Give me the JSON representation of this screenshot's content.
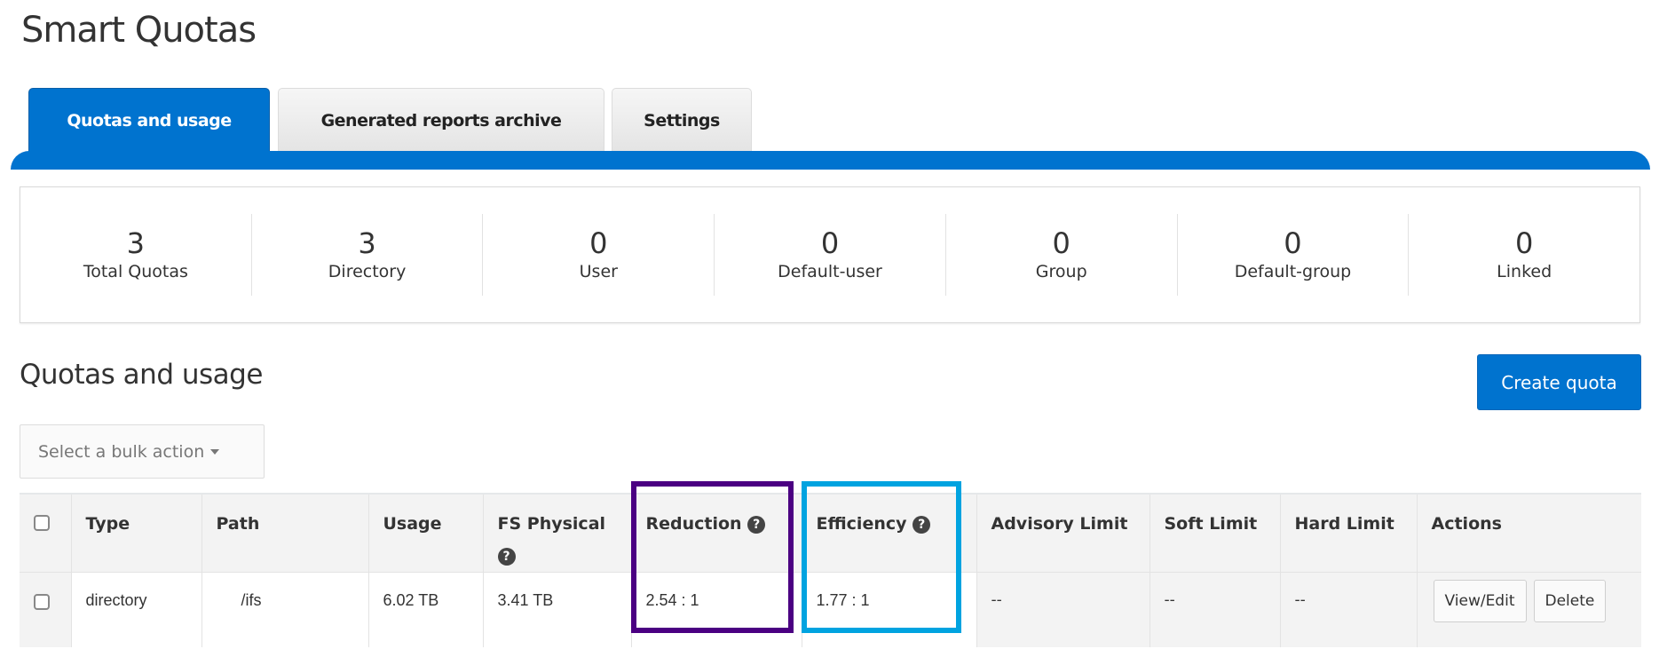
{
  "page": {
    "title": "Smart Quotas"
  },
  "tabs": [
    {
      "label": "Quotas and usage",
      "active": true
    },
    {
      "label": "Generated reports archive",
      "active": false
    },
    {
      "label": "Settings",
      "active": false
    }
  ],
  "stats": [
    {
      "value": "3",
      "label": "Total Quotas"
    },
    {
      "value": "3",
      "label": "Directory"
    },
    {
      "value": "0",
      "label": "User"
    },
    {
      "value": "0",
      "label": "Default-user"
    },
    {
      "value": "0",
      "label": "Group"
    },
    {
      "value": "0",
      "label": "Default-group"
    },
    {
      "value": "0",
      "label": "Linked"
    }
  ],
  "section": {
    "title": "Quotas and usage",
    "create_button": "Create quota",
    "bulk_action_placeholder": "Select a bulk action"
  },
  "table": {
    "headers": {
      "type": "Type",
      "path": "Path",
      "usage": "Usage",
      "fs_physical": "FS Physical",
      "reduction": "Reduction",
      "efficiency": "Efficiency",
      "advisory_limit": "Advisory Limit",
      "soft_limit": "Soft Limit",
      "hard_limit": "Hard Limit",
      "actions": "Actions"
    },
    "rows": [
      {
        "type": "directory",
        "path": "/ifs",
        "usage": "6.02 TB",
        "fs_physical": "3.41 TB",
        "reduction": "2.54 : 1",
        "efficiency": "1.77 : 1",
        "advisory_limit": "--",
        "soft_limit": "--",
        "hard_limit": "--",
        "actions": [
          "View/Edit",
          "Delete"
        ]
      }
    ]
  },
  "icons": {
    "help": "?"
  },
  "colors": {
    "accent": "#0073cf",
    "highlight_reduction": "#4b0082",
    "highlight_efficiency": "#00a3e0"
  }
}
